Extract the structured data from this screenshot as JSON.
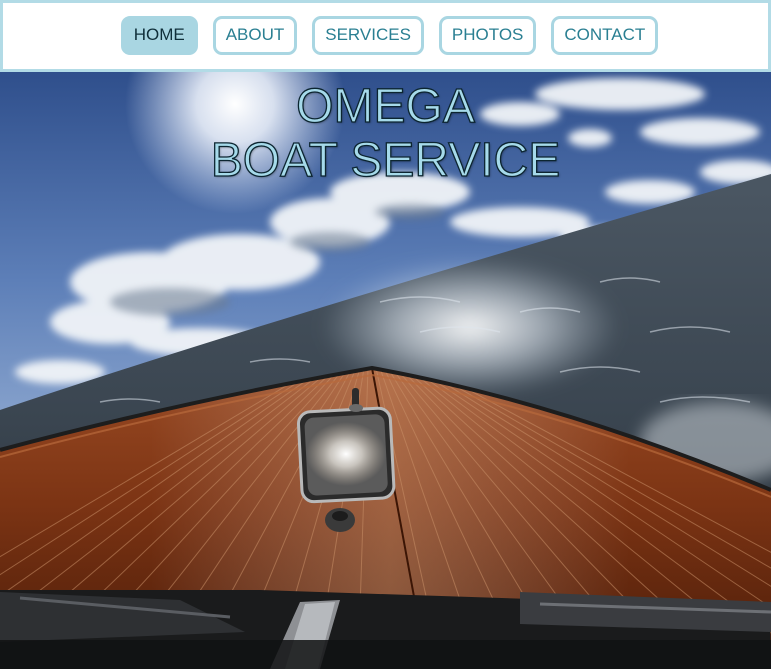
{
  "nav": {
    "items": [
      {
        "label": "HOME",
        "active": true
      },
      {
        "label": "ABOUT",
        "active": false
      },
      {
        "label": "SERVICES",
        "active": false
      },
      {
        "label": "PHOTOS",
        "active": false
      },
      {
        "label": "CONTACT",
        "active": false
      }
    ]
  },
  "hero": {
    "title_line1": "OMEGA",
    "title_line2": "BOAT SERVICE"
  },
  "colors": {
    "accent": "#a9d6e2",
    "nav_text": "#2a7f92",
    "nav_active_text": "#0f2f3a",
    "title_fill": "#a6daea",
    "title_stroke": "#0c2530"
  }
}
